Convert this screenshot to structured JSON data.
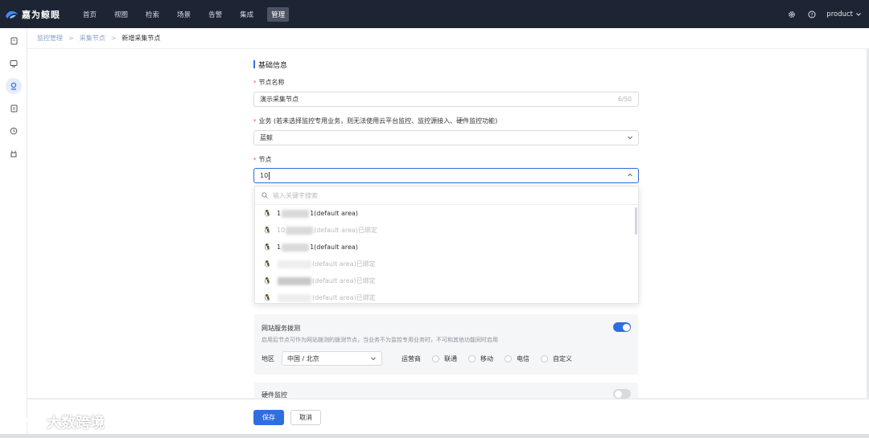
{
  "app": {
    "brand": "嘉为鲸眼",
    "user": "product"
  },
  "nav": {
    "items": [
      "首页",
      "视图",
      "检索",
      "场景",
      "告警",
      "集成",
      "管理"
    ],
    "active": "管理"
  },
  "breadcrumb": {
    "items": [
      "监控管理",
      "采集节点",
      "新增采集节点"
    ],
    "separator": ">"
  },
  "form": {
    "section_title": "基础信息",
    "node_name": {
      "label": "节点名称",
      "value": "演示采集节点",
      "count": "6/50"
    },
    "business": {
      "label": "业务 (若未选择监控专用业务，则无法使用云平台监控、监控源接入、硬件监控功能)",
      "value": "蓝鲸"
    },
    "node": {
      "label": "节点",
      "value": "10"
    },
    "dropdown": {
      "search_placeholder": "输入关键字搜索",
      "options": [
        {
          "prefix": "1",
          "suffix": "1(default area)",
          "disabled": false
        },
        {
          "prefix": "10",
          "suffix": "(default area)已绑定",
          "disabled": true
        },
        {
          "prefix": "1",
          "suffix": "1(default area)",
          "disabled": false
        },
        {
          "prefix": "",
          "suffix": "(default area)已绑定",
          "disabled": true
        },
        {
          "prefix": "",
          "suffix": "(default area)已绑定",
          "disabled": true
        },
        {
          "prefix": "",
          "suffix": "(default area)已绑定",
          "disabled": true
        }
      ]
    },
    "website_probe": {
      "title": "网站服务拨测",
      "description": "启用后节点可作为网站拨测的拨测节点，当业务不为监控专用业务时，不可和其他功能同时启用",
      "enabled": true,
      "region_label": "地区",
      "region_value": "中国 / 北京",
      "carrier_label": "运营商",
      "carriers": [
        "联通",
        "移动",
        "电信",
        "自定义"
      ]
    },
    "hardware_monitor": {
      "title": "硬件监控",
      "enabled": false
    }
  },
  "footer": {
    "save": "保存",
    "cancel": "取消"
  },
  "watermark": {
    "text": "大数跨境"
  },
  "colors": {
    "primary": "#2e6fe0",
    "topbar": "#1d2433",
    "required": "#e34d4d"
  }
}
